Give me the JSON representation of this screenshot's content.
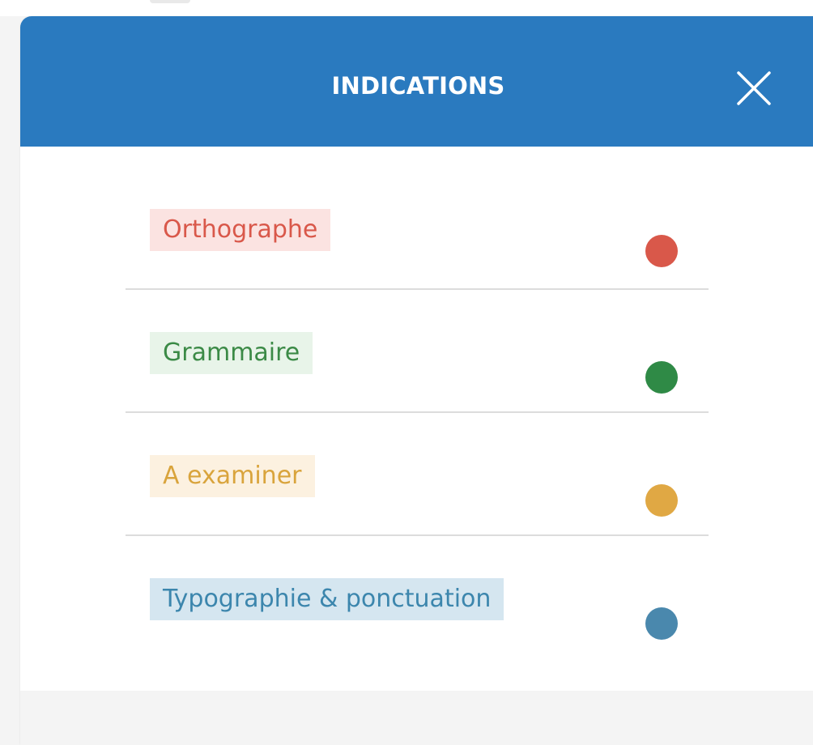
{
  "dialog": {
    "title": "INDICATIONS",
    "close_icon": "close-icon",
    "header_color": "#2a7abf"
  },
  "legend": {
    "items": [
      {
        "label": "Orthographe",
        "text_color": "#d9584a",
        "bg_color": "#fbe3e1",
        "dot_color": "#d9584a"
      },
      {
        "label": "Grammaire",
        "text_color": "#3b8a46",
        "bg_color": "#e8f4e9",
        "dot_color": "#2f8a46"
      },
      {
        "label": "A examiner",
        "text_color": "#d9a43c",
        "bg_color": "#fcf1e0",
        "dot_color": "#e0a844"
      },
      {
        "label": "Typographie & ponctuation",
        "text_color": "#3c86ad",
        "bg_color": "#d5e6f0",
        "dot_color": "#4a88ad"
      }
    ]
  }
}
